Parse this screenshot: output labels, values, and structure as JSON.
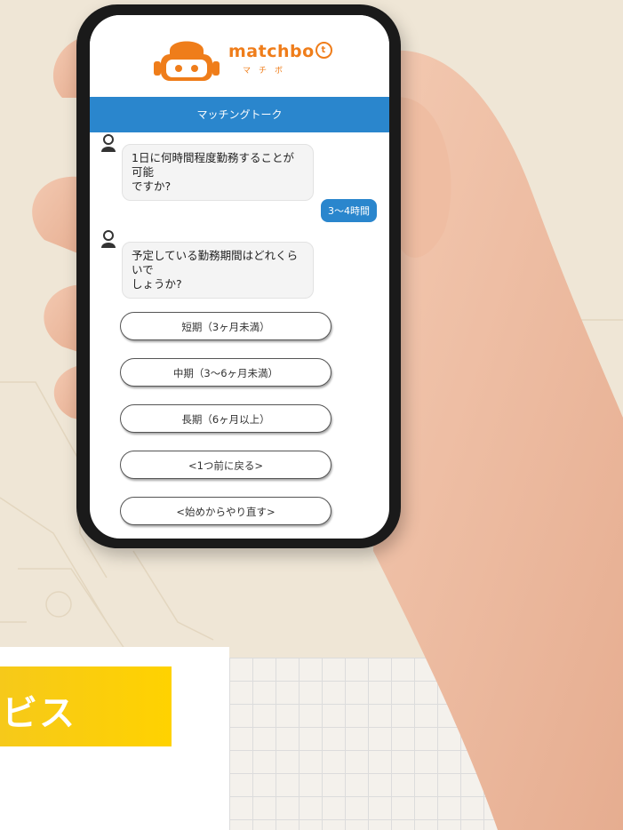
{
  "app": {
    "logo_text": "matchbo",
    "logo_mark": "t",
    "logo_kana": "マチボ",
    "title_bar": "マッチングトーク"
  },
  "chat": {
    "messages": [
      {
        "from": "bot",
        "text_line1": "1日に何時間程度勤務することが可能",
        "text_line2": "ですか?"
      },
      {
        "from": "user",
        "text": "3〜4時間"
      },
      {
        "from": "bot",
        "text_line1": "予定している勤務期間はどれくらいで",
        "text_line2": "しょうか?"
      }
    ],
    "options": [
      "短期（3ヶ月未満）",
      "中期（3〜6ヶ月未満）",
      "長期（6ヶ月以上）",
      "<1つ前に戻る>",
      "<始めからやり直す>"
    ]
  },
  "banner": {
    "partial_text": "ビス"
  },
  "colors": {
    "brand_orange": "#ef7d1a",
    "header_blue": "#2a86cd",
    "banner_yellow": "#ffd200"
  }
}
